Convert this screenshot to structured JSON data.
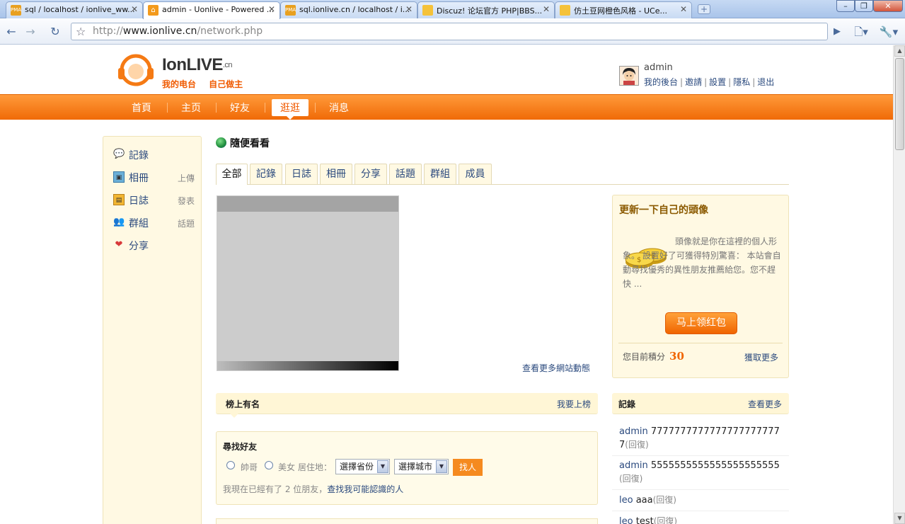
{
  "browser": {
    "tabs": [
      {
        "title": "sql / localhost / ionlive_ww...",
        "favicon": "PMA"
      },
      {
        "title": "admin - Uonlive - Powered ...",
        "favicon": "home"
      },
      {
        "title": "sql.ionlive.cn / localhost / i...",
        "favicon": "PMA"
      },
      {
        "title": "Discuz! 论坛官方 PHP|BBS...",
        "favicon": "chat"
      },
      {
        "title": "仿土豆网橙色风格 - UCe...",
        "favicon": "chat"
      }
    ],
    "active_tab": 1,
    "url_prefix": "http://",
    "url_host": "www.ionlive.cn",
    "url_path": "/network.php"
  },
  "site": {
    "brand": "IonLIVE",
    "brand_suffix": ".cn",
    "slogan": "我的电台 自己做主",
    "user": {
      "name": "admin",
      "menu": [
        "我的後台",
        "邀請",
        "設置",
        "隱私",
        "退出"
      ]
    },
    "nav": [
      "首頁",
      "主页",
      "好友",
      "逛逛",
      "消息"
    ],
    "nav_current": "逛逛"
  },
  "sidebar": {
    "items": [
      {
        "label": "記錄",
        "sub": "",
        "icon": "speech-bubble-icon"
      },
      {
        "label": "相冊",
        "sub": "上傳",
        "icon": "photo-icon"
      },
      {
        "label": "日誌",
        "sub": "發表",
        "icon": "notebook-icon"
      },
      {
        "label": "群組",
        "sub": "話題",
        "icon": "group-icon"
      },
      {
        "label": "分享",
        "sub": "",
        "icon": "hearts-icon"
      }
    ]
  },
  "main": {
    "title": "隨便看看",
    "tabs": [
      "全部",
      "記錄",
      "日誌",
      "相冊",
      "分享",
      "話題",
      "群組",
      "成員"
    ],
    "active_tab": "全部",
    "more_news": "查看更多網站動態"
  },
  "promo": {
    "title": "更新一下自己的頭像",
    "desc": "頭像就是你在這裡的個人形象。 設置好了可獲得特別驚喜： 本站會自動尋找優秀的異性朋友推薦給您。您不趕快 ...",
    "button": "马上领红包",
    "points_label": "您目前積分",
    "points": "30",
    "earn_more": "獲取更多"
  },
  "rank": {
    "title": "榜上有名",
    "more": "我要上榜"
  },
  "finder": {
    "title": "尋找好友",
    "male": "帥哥",
    "female": "美女",
    "location_label": "居住地：",
    "province": "選擇省份",
    "city": "選擇城市",
    "button": "找人",
    "note_prefix": "我現在已經有了 2 位朋友，",
    "note_link": "查找我可能認識的人"
  },
  "records": {
    "title": "記錄",
    "more": "查看更多",
    "items": [
      {
        "user": "admin",
        "text": "77777777777777777777777",
        "reply": "(回復)"
      },
      {
        "user": "admin",
        "text": "5555555555555555555555",
        "reply": "(回復)"
      },
      {
        "user": "leo",
        "text": "aaa",
        "reply": "(回復)"
      },
      {
        "user": "leo",
        "text": "test",
        "reply": "(回復)"
      }
    ]
  },
  "colors": {
    "accent": "#f06a07",
    "link": "#2b4a7e",
    "panel": "#fff9e3"
  }
}
